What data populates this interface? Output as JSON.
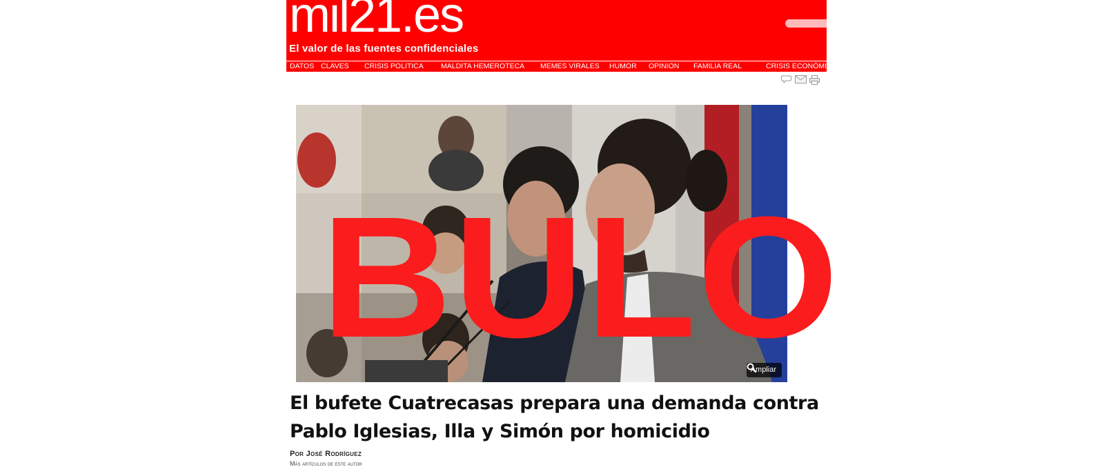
{
  "header": {
    "logo_text": "mil21.es",
    "tagline": "El valor de las fuentes confidenciales",
    "brand_color": "#ff0000"
  },
  "nav": {
    "items": [
      {
        "label": "DATOS"
      },
      {
        "label": "CLAVES"
      },
      {
        "label": "CRISIS POLITICA"
      },
      {
        "label": "MALDITA HEMEROTECA"
      },
      {
        "label": "MEMES VIRALES"
      },
      {
        "label": "HUMOR"
      },
      {
        "label": "OPINION"
      },
      {
        "label": "FAMILIA REAL"
      },
      {
        "label": "CRISIS ECONÓMIC"
      }
    ]
  },
  "tools": {
    "icons": [
      "comment-icon",
      "email-icon",
      "print-icon"
    ]
  },
  "photo": {
    "enlarge_label": "Ampliar",
    "enlarge_icon": "magnifier-icon"
  },
  "stamp": {
    "text": "BULO",
    "color": "#fb1d1d"
  },
  "article": {
    "headline": "El bufete Cuatrecasas prepara una demanda contra Pablo Iglesias, Illa y Simón por homicidio",
    "byline": "Por José Rodríguez",
    "more_articles": "Más artículos de este autor"
  }
}
